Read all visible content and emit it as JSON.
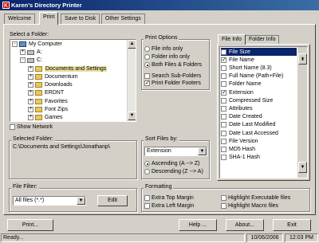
{
  "window": {
    "title": "Karen's Directory Printer",
    "icon_letter": "K"
  },
  "tabs": [
    {
      "label": "Welcome"
    },
    {
      "label": "Print"
    },
    {
      "label": "Save to Disk"
    },
    {
      "label": "Other Settings"
    }
  ],
  "folder_select": {
    "label": "Select a Folder:",
    "tree": [
      {
        "label": "My Computer",
        "kind": "pc",
        "expander": "-"
      },
      {
        "label": "A:",
        "kind": "drive",
        "expander": "+"
      },
      {
        "label": "C:",
        "kind": "drive",
        "expander": "-"
      },
      {
        "label": "Documents and Settings",
        "kind": "folder",
        "expander": "+"
      },
      {
        "label": "Documentum",
        "kind": "folder",
        "expander": "+"
      },
      {
        "label": "Downloads",
        "kind": "folder",
        "expander": "+"
      },
      {
        "label": "ERDNT",
        "kind": "folder",
        "expander": "+"
      },
      {
        "label": "Favorites",
        "kind": "folder",
        "expander": "+"
      },
      {
        "label": "Font Zips",
        "kind": "folder",
        "expander": "+"
      },
      {
        "label": "Games",
        "kind": "folder",
        "expander": "+"
      }
    ],
    "show_network_label": "Show Network"
  },
  "print_options": {
    "title": "Print Options",
    "files_only": "File info only",
    "folders_only": "Folder info only",
    "both": "Both Files & Folders",
    "search_subfolders": "Search Sub-Folders",
    "print_folder_footers": "Print Folder Footers"
  },
  "info_tabs": {
    "file_info": "File Info",
    "folder_info": "Folder Info"
  },
  "fields": [
    {
      "label": "File Size",
      "checked": true
    },
    {
      "label": "File Name",
      "checked": true
    },
    {
      "label": "Short Name (8.3)",
      "checked": false
    },
    {
      "label": "Full Name (Path+File)",
      "checked": false
    },
    {
      "label": "Folder Name",
      "checked": false
    },
    {
      "label": "Extension",
      "checked": true
    },
    {
      "label": "Compressed Size",
      "checked": false
    },
    {
      "label": "Attributes",
      "checked": false
    },
    {
      "label": "Date Created",
      "checked": false
    },
    {
      "label": "Date Last Modified",
      "checked": false
    },
    {
      "label": "Date Last Accessed",
      "checked": false
    },
    {
      "label": "File Version",
      "checked": false
    },
    {
      "label": "MD5 Hash",
      "checked": false
    },
    {
      "label": "SHA-1 Hash",
      "checked": false
    }
  ],
  "selected_folder": {
    "label": "Selected Folder:",
    "value": "C:\\Documents and Settings\\Jonathanp\\"
  },
  "sort": {
    "label": "Sort Files by:",
    "value": "Extension",
    "ascending": "Ascending (A --> Z)",
    "descending": "Descending (Z --> A)"
  },
  "file_filter": {
    "label": "File Filter:",
    "value": "All files (*.*)",
    "edit": "Edit"
  },
  "formatting": {
    "title": "Formatting",
    "extra_top": "Extra Top Margin",
    "extra_left": "Extra Left Margin",
    "highlight_exec": "Highlight Executable files",
    "highlight_macro": "Highlight Macro files"
  },
  "buttons": {
    "print": "Print...",
    "help": "Help ...",
    "about": "About...",
    "exit": "Exit"
  },
  "status": {
    "text": "Ready...",
    "date": "10/06/2006",
    "time": "12:03 PM"
  }
}
